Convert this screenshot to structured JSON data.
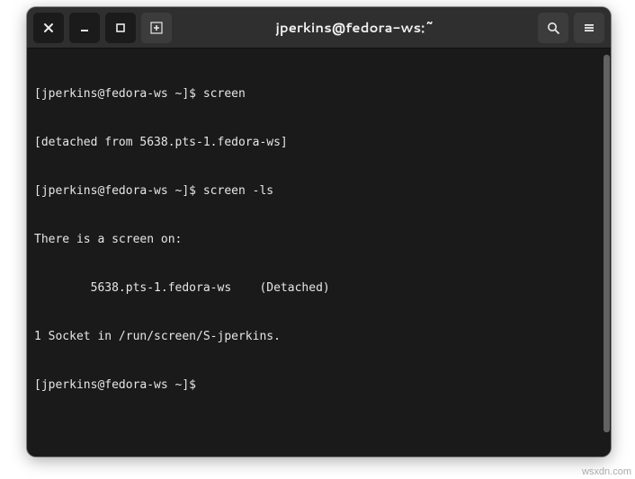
{
  "window": {
    "title": "jperkins@fedora-ws:~"
  },
  "terminal": {
    "lines": [
      "[jperkins@fedora-ws ~]$ screen",
      "[detached from 5638.pts-1.fedora-ws]",
      "[jperkins@fedora-ws ~]$ screen -ls",
      "There is a screen on:",
      "        5638.pts-1.fedora-ws    (Detached)",
      "1 Socket in /run/screen/S-jperkins.",
      "[jperkins@fedora-ws ~]$ "
    ]
  },
  "watermark": "wsxdn.com"
}
